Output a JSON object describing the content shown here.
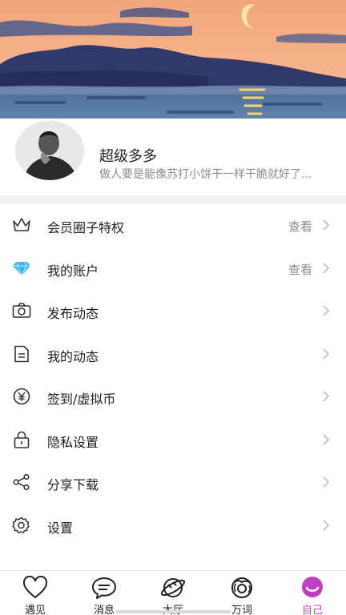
{
  "profile": {
    "name": "超级多多",
    "bio": "做人要是能像苏打小饼干一样干脆就好了..."
  },
  "menu": [
    {
      "label": "会员圈子特权",
      "action": "查看",
      "icon": "crown-icon"
    },
    {
      "label": "我的账户",
      "action": "查看",
      "icon": "diamond-icon"
    },
    {
      "label": "发布动态",
      "action": "",
      "icon": "camera-icon"
    },
    {
      "label": "我的动态",
      "action": "",
      "icon": "document-icon"
    },
    {
      "label": "签到/虚拟币",
      "action": "",
      "icon": "yen-coin-icon"
    },
    {
      "label": "隐私设置",
      "action": "",
      "icon": "lock-icon"
    },
    {
      "label": "分享下载",
      "action": "",
      "icon": "share-icon"
    },
    {
      "label": "设置",
      "action": "",
      "icon": "gear-icon"
    }
  ],
  "tabs": [
    {
      "label": "遇见",
      "icon": "heart-icon"
    },
    {
      "label": "消息",
      "icon": "chat-bubble-icon"
    },
    {
      "label": "大厅",
      "icon": "planet-icon"
    },
    {
      "label": "万词",
      "icon": "donut-icon"
    },
    {
      "label": "自己",
      "icon": "smile-icon",
      "active": true
    }
  ],
  "colors": {
    "accent": "#c23fc4",
    "diamond": "#3fb6e8",
    "sky": "#f3a27c",
    "water": "#3d5a80"
  }
}
